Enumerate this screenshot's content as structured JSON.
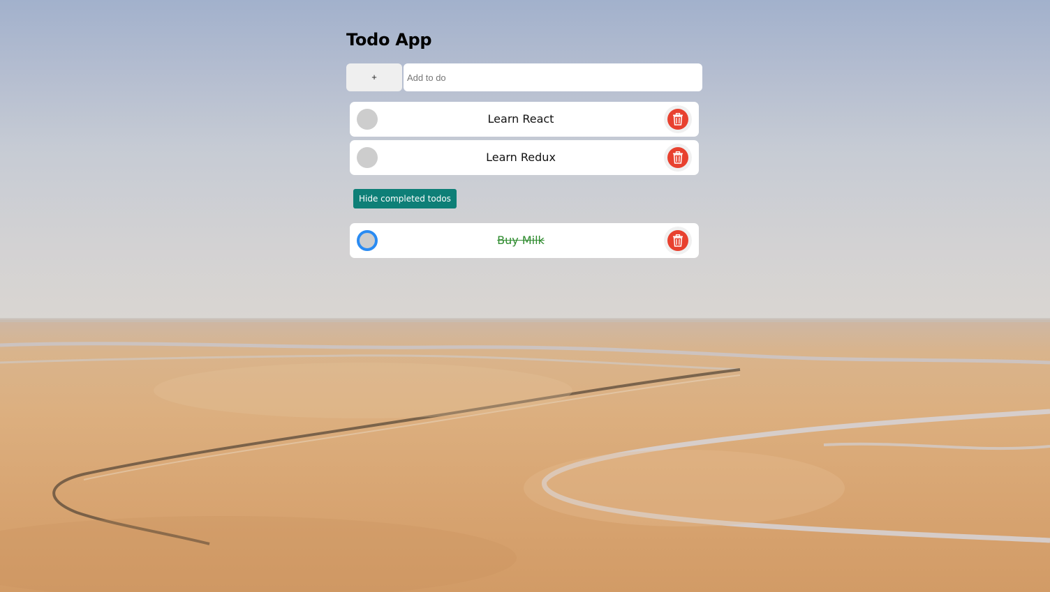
{
  "app": {
    "title": "Todo App"
  },
  "add_form": {
    "add_button_label": "+",
    "input_placeholder": "Add to do",
    "input_value": ""
  },
  "active_todos": [
    {
      "label": "Learn React",
      "completed": false
    },
    {
      "label": "Learn Redux",
      "completed": false
    }
  ],
  "toggle_completed": {
    "label": "Hide completed todos"
  },
  "completed_todos": [
    {
      "label": "Buy Milk",
      "completed": true
    }
  ],
  "icons": {
    "checkbox": "circle-checkbox-icon",
    "delete": "trash-icon"
  },
  "colors": {
    "delete_button": "#e8412f",
    "checkbox_completed_ring": "#2a8bf2",
    "completed_text": "#2e8b2e",
    "toggle_button": "#0e7f77"
  }
}
